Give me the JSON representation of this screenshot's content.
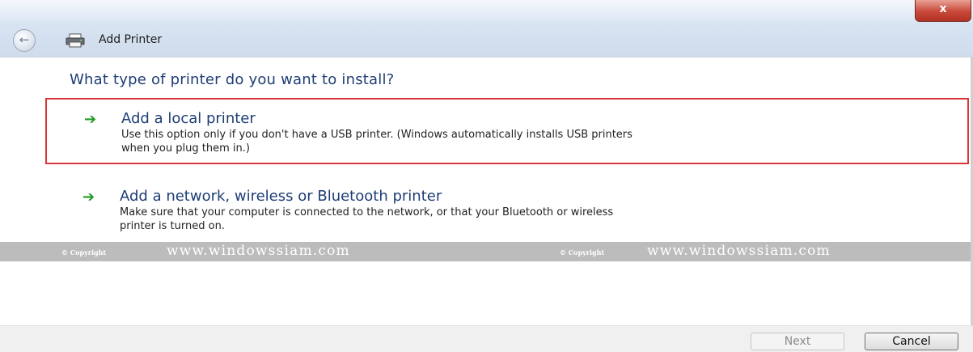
{
  "window": {
    "title": "Add Printer",
    "close_label": "x",
    "back_glyph": "←"
  },
  "heading": "What type of printer do you want to install?",
  "options": [
    {
      "title": "Add a local printer",
      "description_line1": "Use this option only if you don't have a USB printer. (Windows automatically installs USB printers",
      "description_line2": "when you plug them in.)",
      "selected": true
    },
    {
      "title": "Add a network, wireless or Bluetooth printer",
      "description_line1": "Make sure that your computer is connected to the network, or that your Bluetooth or wireless",
      "description_line2": "printer is turned on.",
      "selected": false
    }
  ],
  "watermark": {
    "copyright_label": "© Copyright",
    "url": "www.windowssiam.com"
  },
  "buttons": {
    "next": "Next",
    "cancel": "Cancel"
  },
  "icons": {
    "back": "back-arrow-icon",
    "printer": "printer-icon",
    "option_arrow": "green-arrow-icon",
    "close": "close-icon"
  },
  "colors": {
    "heading": "#1e3d75",
    "selection_border": "#d9363a",
    "arrow": "#1f9b25",
    "close_button": "#c8483a"
  }
}
